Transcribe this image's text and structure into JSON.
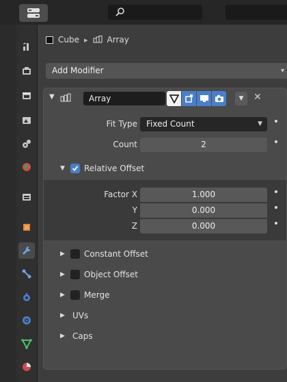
{
  "header": {
    "editor_type_icon": "properties-editor-icon",
    "search_icon": "search-icon"
  },
  "tabs": [
    {
      "name": "tool-tab",
      "icon": "tool-icon"
    },
    {
      "name": "render-tab",
      "icon": "render-icon"
    },
    {
      "name": "output-tab",
      "icon": "output-icon"
    },
    {
      "name": "view-layer-tab",
      "icon": "view-layer-icon"
    },
    {
      "name": "scene-tab",
      "icon": "scene-icon"
    },
    {
      "name": "world-tab",
      "icon": "world-icon"
    },
    {
      "name": "collection-tab",
      "icon": "collection-icon"
    },
    {
      "name": "object-tab",
      "icon": "object-icon"
    },
    {
      "name": "modifier-tab",
      "icon": "wrench-icon",
      "active": true
    },
    {
      "name": "particles-tab",
      "icon": "particles-icon"
    },
    {
      "name": "physics-tab",
      "icon": "physics-icon"
    },
    {
      "name": "constraints-tab",
      "icon": "constraints-icon"
    },
    {
      "name": "data-tab",
      "icon": "mesh-data-icon"
    },
    {
      "name": "material-tab",
      "icon": "material-icon"
    }
  ],
  "breadcrumb": {
    "object": "Cube",
    "modifier": "Array"
  },
  "add_modifier_label": "Add Modifier",
  "modifier": {
    "name": "Array",
    "fit_type_label": "Fit Type",
    "fit_type_value": "Fixed Count",
    "count_label": "Count",
    "count_value": "2",
    "relative_offset_label": "Relative Offset",
    "factor_x_label": "Factor X",
    "factor_y_label": "Y",
    "factor_z_label": "Z",
    "factor_x": "1.000",
    "factor_y": "0.000",
    "factor_z": "0.000",
    "constant_offset_label": "Constant Offset",
    "object_offset_label": "Object Offset",
    "merge_label": "Merge",
    "uvs_label": "UVs",
    "caps_label": "Caps"
  },
  "colors": {
    "accent": "#4a7fc9",
    "panel": "#4a4a4a",
    "background": "#3d3d3d"
  }
}
